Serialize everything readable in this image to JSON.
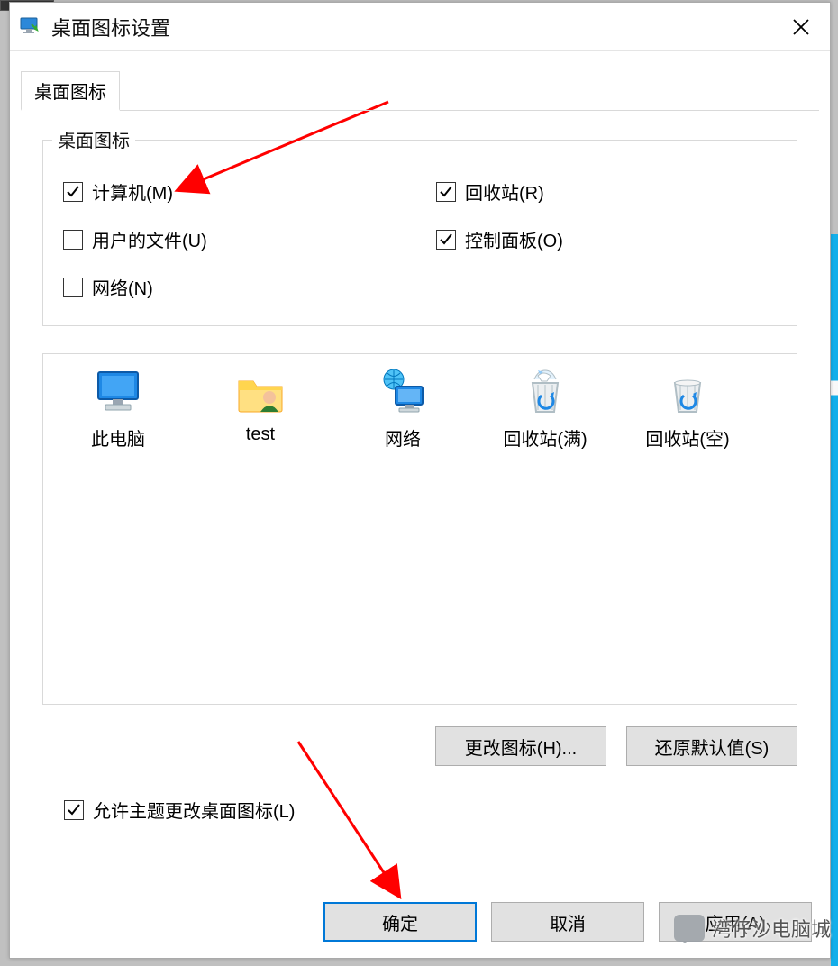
{
  "dialog": {
    "title": "桌面图标设置",
    "tab": {
      "label": "桌面图标"
    },
    "group": {
      "legend": "桌面图标",
      "checks": {
        "computer": {
          "label": "计算机(M)",
          "checked": true
        },
        "recycle": {
          "label": "回收站(R)",
          "checked": true
        },
        "user_files": {
          "label": "用户的文件(U)",
          "checked": false
        },
        "ctrl_panel": {
          "label": "控制面板(O)",
          "checked": true
        },
        "network": {
          "label": "网络(N)",
          "checked": false
        }
      }
    },
    "icons": {
      "this_pc": {
        "label": "此电脑"
      },
      "user_folder": {
        "label": "test"
      },
      "network": {
        "label": "网络"
      },
      "recycle_full": {
        "label": "回收站(满)"
      },
      "recycle_empty": {
        "label": "回收站(空)"
      }
    },
    "icon_buttons": {
      "change": "更改图标(H)...",
      "restore": "还原默认值(S)"
    },
    "allow_theme": {
      "label": "允许主题更改桌面图标(L)",
      "checked": true
    },
    "action_buttons": {
      "ok": "确定",
      "cancel": "取消",
      "apply": "应用(A)"
    }
  },
  "watermark": {
    "text": "湾仔沙电脑城"
  }
}
